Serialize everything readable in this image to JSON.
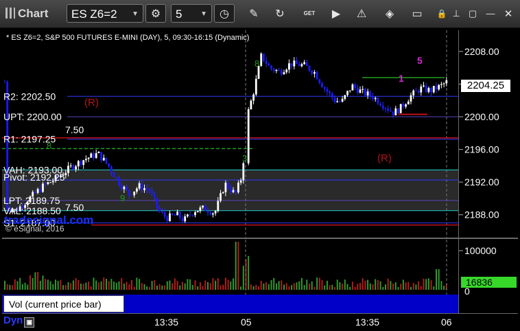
{
  "toolbar": {
    "app_title": "Chart",
    "symbol": "ES Z6=2",
    "interval": "5",
    "icons": [
      "settings-gear-icon",
      "clock-icon",
      "pencil-icon",
      "refresh-icon",
      "get-icon",
      "play-icon",
      "alert-icon",
      "eraser-icon",
      "comment-icon",
      "lock-icon",
      "pin-icon",
      "maximize-icon",
      "close-icon"
    ],
    "get_label": "GET"
  },
  "chart_header": "* ES Z6=2, S&P 500 FUTURES E-MINI (DAY), 5, 09:30-16:15 (Dynamic)",
  "watermark": "© eSignal, 2016",
  "tradesignal_label": "tradesignal.com",
  "chart_data": {
    "type": "candlestick",
    "title": "* ES Z6=2, S&P 500 FUTURES E-MINI (DAY), 5, 09:30-16:15 (Dynamic)",
    "price_axis": {
      "ticks": [
        "2208.00",
        "2204.00",
        "2200.00",
        "2196.00",
        "2192.00",
        "2188.00"
      ],
      "tick_values": [
        2208,
        2204,
        2200,
        2196,
        2192,
        2188
      ],
      "ylim": [
        2185.2,
        2210.6
      ],
      "last_price": "2204.25"
    },
    "levels": [
      {
        "label": "R2: 2202.50",
        "value": 2202.5,
        "color": "#2e3aff"
      },
      {
        "label": "UPT: 2200.00",
        "value": 2200.0,
        "color": "#5b45c0"
      },
      {
        "label": "R1: 2197.25",
        "value": 2197.25,
        "color": "#2e3aff"
      },
      {
        "label": "VAH: 2193.00",
        "value": 2193.5,
        "color": "#20d0d0"
      },
      {
        "label": "Pivot: 2192.25",
        "value": 2192.25,
        "color": "#2e3aff"
      },
      {
        "label": "LPT: 2189.75",
        "value": 2189.75,
        "color": "#5b45c0"
      },
      {
        "label": "VAL: 2188.50",
        "value": 2188.5,
        "color": "#20d0d0"
      },
      {
        "label": "S1: 2187.00",
        "value": 2187.0,
        "color": "#2e3aff"
      }
    ],
    "marker_labels": [
      "7.50",
      "7.50",
      "(R)",
      "(R)",
      "8",
      "9",
      "8",
      "3",
      "1",
      "5"
    ],
    "time_axis": [
      "13:35",
      "05",
      "13:35",
      "06"
    ],
    "session_breaks": [
      "05",
      "06"
    ],
    "volume_axis": {
      "ticks": [
        "100000",
        "0"
      ],
      "last_volume": "16836"
    },
    "indicator_label": "Vol (current price bar)",
    "up_color": "#ffffff",
    "down_color": "#1a1aff"
  },
  "footer": {
    "left_label": "Dyn"
  }
}
